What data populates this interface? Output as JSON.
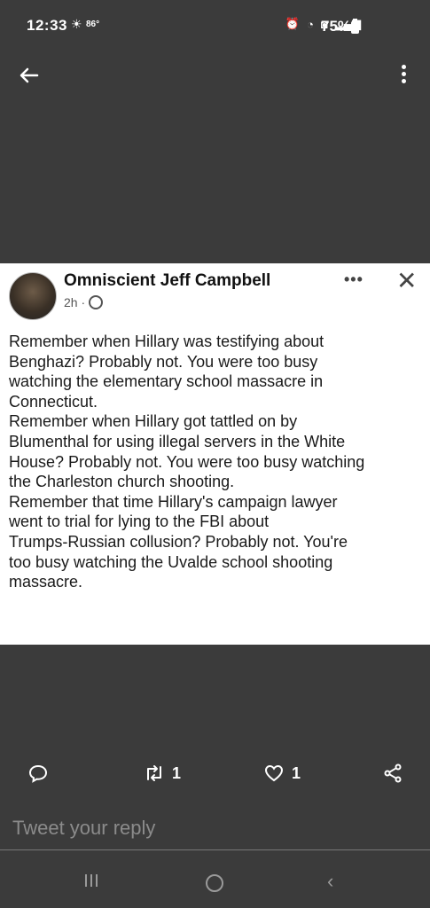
{
  "status_bar": {
    "time": "12:33",
    "weather_icon": "sun-icon",
    "temperature": "86°",
    "battery": "75%"
  },
  "top_bar": {
    "back_icon": "arrow-left-icon",
    "menu_icon": "vertical-dots-icon"
  },
  "post": {
    "author": "Omniscient Jeff Campbell",
    "time_ago": "2h ·",
    "privacy_icon": "globe-icon",
    "menu_icon": "horizontal-dots-icon",
    "close_icon": "close-icon",
    "body_lines": [
      "Remember when Hillary was testifying about",
      "Benghazi? Probably not. You were too busy",
      "watching the elementary school massacre in",
      "Connecticut.",
      "Remember when Hillary got tattled on by",
      "Blumenthal for using illegal servers in the White",
      "House? Probably not. You were too busy watching",
      "the Charleston church shooting.",
      "Remember that time Hillary's campaign lawyer",
      "went to trial for lying to the FBI about",
      "Trumps-Russian collusion? Probably not. You're",
      "too busy watching the Uvalde school shooting",
      "massacre."
    ]
  },
  "actions": {
    "reply_count": "",
    "retweet_count": "1",
    "like_count": "1"
  },
  "reply": {
    "placeholder": "Tweet your reply"
  },
  "colors": {
    "background": "#3b3b3b",
    "card": "#ffffff",
    "text": "#1a1a1a"
  }
}
